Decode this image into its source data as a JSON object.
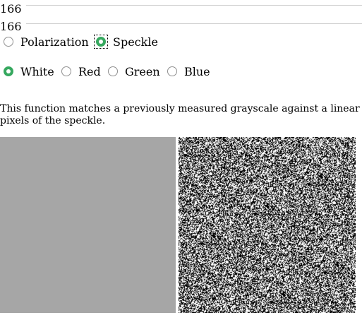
{
  "sliders": [
    {
      "value": "166"
    },
    {
      "value": "166"
    }
  ],
  "mode": {
    "options": [
      {
        "label": "Polarization",
        "checked": false
      },
      {
        "label": "Speckle",
        "checked": true
      }
    ]
  },
  "color": {
    "options": [
      {
        "label": "White",
        "checked": true
      },
      {
        "label": "Red",
        "checked": false
      },
      {
        "label": "Green",
        "checked": false
      },
      {
        "label": "Blue",
        "checked": false
      }
    ]
  },
  "description": {
    "line1": "This function matches a previously measured grayscale against a linear",
    "line2": "pixels of the speckle."
  },
  "colors": {
    "gray_patch": "#a6a6a6",
    "radio_accent": "#36a85f",
    "slider_track": "#cfcfcf"
  }
}
